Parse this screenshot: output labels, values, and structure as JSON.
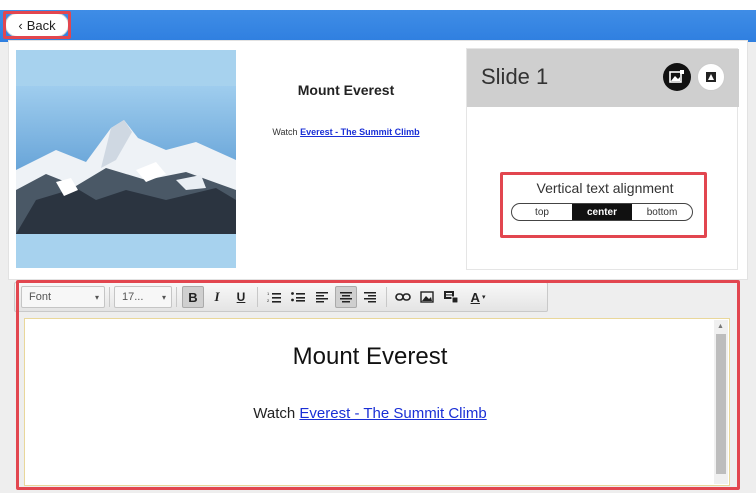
{
  "header": {
    "back_label": "Back"
  },
  "slide_preview": {
    "title": "Mount Everest",
    "watch_prefix": "Watch ",
    "watch_link": "Everest - The Summit Climb"
  },
  "side_panel": {
    "slide_label": "Slide 1",
    "icons": [
      "add-image-icon",
      "image-edit-icon"
    ],
    "vertical_alignment": {
      "label": "Vertical text alignment",
      "options": [
        "top",
        "center",
        "bottom"
      ],
      "selected": "center"
    }
  },
  "toolbar": {
    "font_label": "Font",
    "size_label": "17...",
    "bold": "B",
    "italic": "I",
    "underline": "U",
    "font_color": "A",
    "icons": [
      "numbered-list-icon",
      "bullet-list-icon",
      "align-left-icon",
      "align-center-icon",
      "align-right-icon",
      "link-icon",
      "image-icon",
      "embed-icon",
      "font-color-icon"
    ]
  },
  "editor": {
    "title": "Mount Everest",
    "watch_prefix": "Watch ",
    "watch_link": "Everest - The Summit Climb"
  },
  "colors": {
    "top_bar": "#3f8de6",
    "highlight": "#e2464f",
    "link": "#1a2fd6"
  }
}
